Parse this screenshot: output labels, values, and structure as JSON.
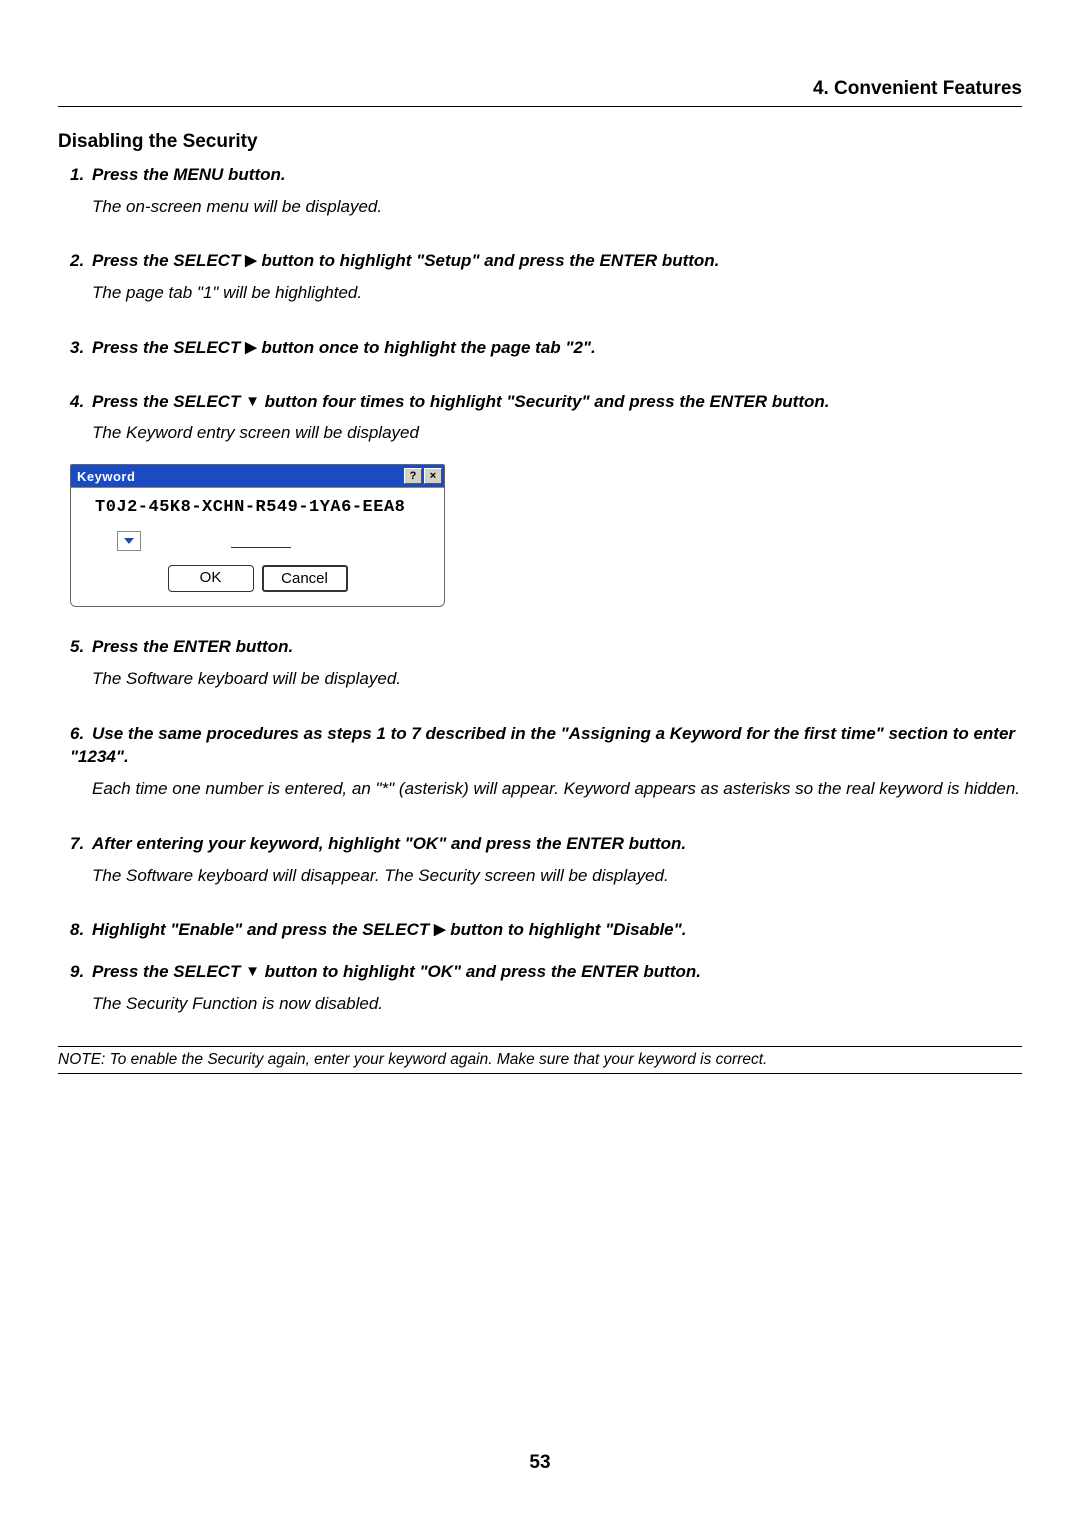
{
  "chapter": "4. Convenient Features",
  "section_title": "Disabling the Security",
  "steps": [
    {
      "num": "1.",
      "instruction_pre": "Press the MENU button.",
      "note": "The on-screen menu will be displayed."
    },
    {
      "num": "2.",
      "instruction_pre": "Press the SELECT ",
      "arrow": "▶",
      "instruction_post": " button to highlight \"Setup\" and press the ENTER button.",
      "note": "The page tab \"1\" will be highlighted."
    },
    {
      "num": "3.",
      "instruction_pre": "Press the SELECT ",
      "arrow": "▶",
      "instruction_post": " button once to highlight the page tab \"2\"."
    },
    {
      "num": "4.",
      "instruction_pre": "Press the SELECT ",
      "arrow": "▼",
      "instruction_post": " button four times to highlight \"Security\" and press the ENTER button.",
      "note": "The Keyword entry screen will be displayed"
    },
    {
      "num": "5.",
      "instruction_pre": "Press the ENTER button.",
      "note": "The Software keyboard will be displayed."
    },
    {
      "num": "6.",
      "instruction_pre": "Use the same procedures as steps 1 to 7 described in the \"Assigning a Keyword for the first time\" section to enter \"1234\".",
      "note": "Each time one number is entered, an \"*\" (asterisk) will appear. Keyword appears as asterisks so the real keyword is hidden."
    },
    {
      "num": "7.",
      "instruction_pre": "After entering your keyword, highlight \"OK\" and press the ENTER button.",
      "note": "The Software keyboard will disappear. The Security screen will be displayed."
    },
    {
      "num": "8.",
      "instruction_pre": "Highlight \"Enable\" and press the SELECT ",
      "arrow": "▶",
      "instruction_post": " button to highlight \"Disable\"."
    },
    {
      "num": "9.",
      "instruction_pre": "Press the SELECT ",
      "arrow": "▼",
      "instruction_post": " button to highlight \"OK\" and press the ENTER button.",
      "note": "The Security Function is now disabled."
    }
  ],
  "dialog": {
    "title": "Keyword",
    "help_label": "?",
    "close_label": "×",
    "code": "T0J2-45K8-XCHN-R549-1YA6-EEA8",
    "ok_label": "OK",
    "cancel_label": "Cancel"
  },
  "footer_note": "NOTE: To enable the Security again, enter your keyword again. Make sure that your keyword is correct.",
  "page_number": "53"
}
